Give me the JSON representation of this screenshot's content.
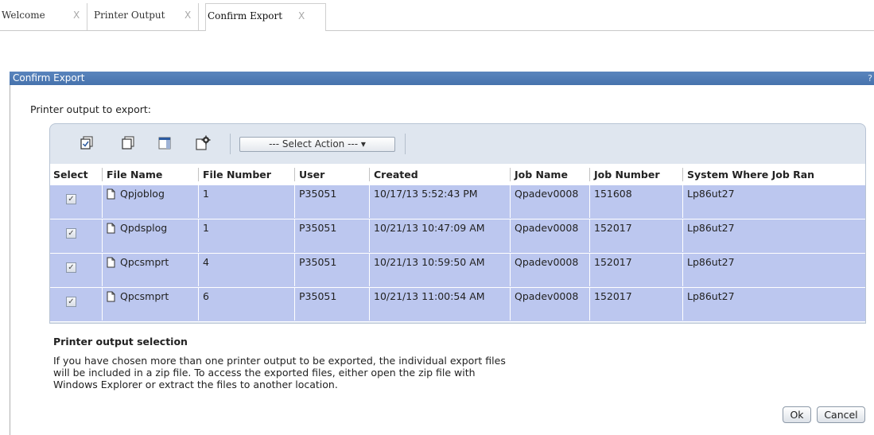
{
  "tabs": [
    {
      "label": "Welcome",
      "active": false
    },
    {
      "label": "Printer Output",
      "active": false
    },
    {
      "label": "Confirm Export",
      "active": true
    }
  ],
  "tab_close_glyph": "X",
  "dialog": {
    "title": "Confirm Export",
    "help_glyph": "?",
    "prompt": "Printer output to export:"
  },
  "toolbar": {
    "icons": [
      "select-all-icon",
      "deselect-all-icon",
      "columns-icon",
      "table-settings-icon"
    ],
    "select_action": "--- Select Action --- ▾"
  },
  "table": {
    "columns": [
      "Select",
      "File Name",
      "File Number",
      "User",
      "Created",
      "Job Name",
      "Job Number",
      "System Where Job Ran"
    ],
    "rows": [
      {
        "checked": true,
        "file_name": "Qpjoblog",
        "file_number": "1",
        "user": "P35051",
        "created": "10/17/13 5:52:43 PM",
        "job_name": "Qpadev0008",
        "job_number": "151608",
        "system": "Lp86ut27"
      },
      {
        "checked": true,
        "file_name": "Qpdsplog",
        "file_number": "1",
        "user": "P35051",
        "created": "10/21/13 10:47:09 AM",
        "job_name": "Qpadev0008",
        "job_number": "152017",
        "system": "Lp86ut27"
      },
      {
        "checked": true,
        "file_name": "Qpcsmprt",
        "file_number": "4",
        "user": "P35051",
        "created": "10/21/13 10:59:50 AM",
        "job_name": "Qpadev0008",
        "job_number": "152017",
        "system": "Lp86ut27"
      },
      {
        "checked": true,
        "file_name": "Qpcsmprt",
        "file_number": "6",
        "user": "P35051",
        "created": "10/21/13 11:00:54 AM",
        "job_name": "Qpadev0008",
        "job_number": "152017",
        "system": "Lp86ut27"
      }
    ]
  },
  "help": {
    "title": "Printer output selection",
    "lines": [
      "If you have chosen more than one printer output to be exported, the individual export files",
      "will be included in a zip file. To access the exported files, either open the zip file with",
      "Windows Explorer or extract the files to another location."
    ]
  },
  "buttons": {
    "ok": "Ok",
    "cancel": "Cancel"
  },
  "colors": {
    "title_bar": "#4f7bb6",
    "panel": "#dfe6ef",
    "row": "#bcc7ef"
  }
}
